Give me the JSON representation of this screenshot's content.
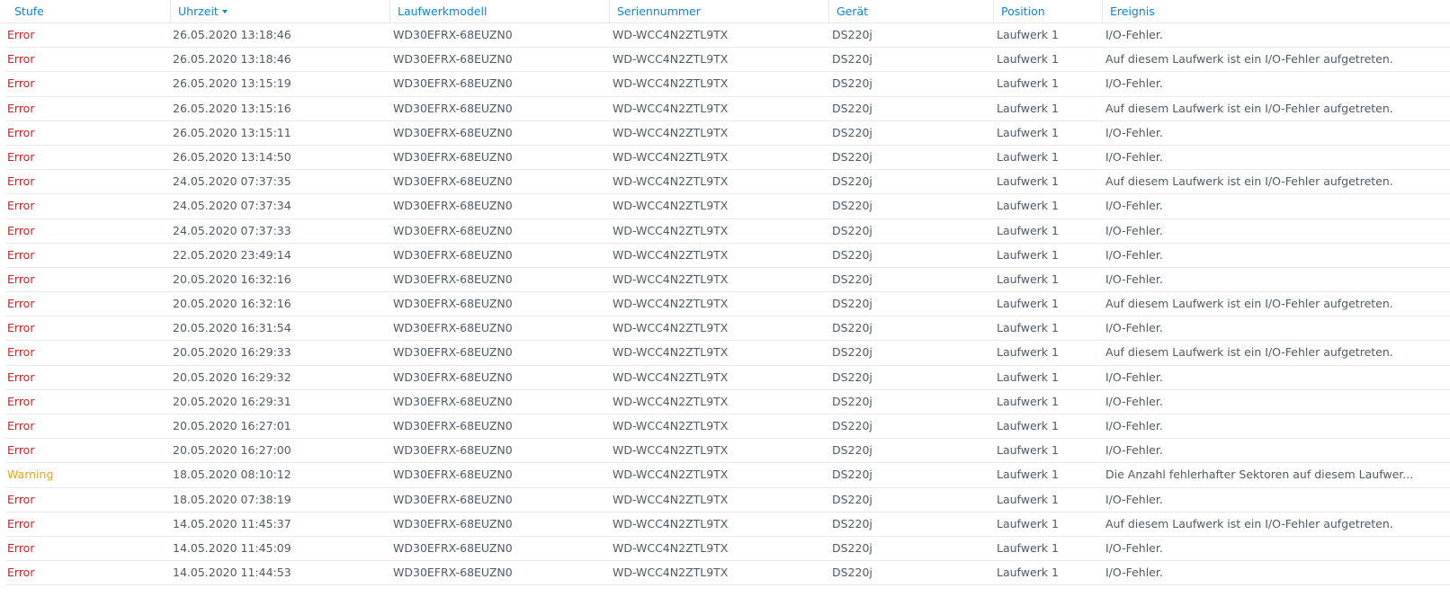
{
  "columns": [
    {
      "label": "Stufe"
    },
    {
      "label": "Uhrzeit",
      "sorted": "desc"
    },
    {
      "label": "Laufwerkmodell"
    },
    {
      "label": "Seriennummer"
    },
    {
      "label": "Gerät"
    },
    {
      "label": "Position"
    },
    {
      "label": "Ereignis"
    }
  ],
  "colors": {
    "header_text": "#0b86d4",
    "error": "#e01b1b",
    "warning": "#f0a30a",
    "text": "#505a64"
  },
  "rows": [
    {
      "level": "Error",
      "time": "26.05.2020 13:18:46",
      "model": "WD30EFRX-68EUZN0",
      "serial": "WD-WCC4N2ZTL9TX",
      "device": "DS220j",
      "position": "Laufwerk 1",
      "event": "I/O-Fehler."
    },
    {
      "level": "Error",
      "time": "26.05.2020 13:18:46",
      "model": "WD30EFRX-68EUZN0",
      "serial": "WD-WCC4N2ZTL9TX",
      "device": "DS220j",
      "position": "Laufwerk 1",
      "event": "Auf diesem Laufwerk ist ein I/O-Fehler aufgetreten."
    },
    {
      "level": "Error",
      "time": "26.05.2020 13:15:19",
      "model": "WD30EFRX-68EUZN0",
      "serial": "WD-WCC4N2ZTL9TX",
      "device": "DS220j",
      "position": "Laufwerk 1",
      "event": "I/O-Fehler."
    },
    {
      "level": "Error",
      "time": "26.05.2020 13:15:16",
      "model": "WD30EFRX-68EUZN0",
      "serial": "WD-WCC4N2ZTL9TX",
      "device": "DS220j",
      "position": "Laufwerk 1",
      "event": "Auf diesem Laufwerk ist ein I/O-Fehler aufgetreten."
    },
    {
      "level": "Error",
      "time": "26.05.2020 13:15:11",
      "model": "WD30EFRX-68EUZN0",
      "serial": "WD-WCC4N2ZTL9TX",
      "device": "DS220j",
      "position": "Laufwerk 1",
      "event": "I/O-Fehler."
    },
    {
      "level": "Error",
      "time": "26.05.2020 13:14:50",
      "model": "WD30EFRX-68EUZN0",
      "serial": "WD-WCC4N2ZTL9TX",
      "device": "DS220j",
      "position": "Laufwerk 1",
      "event": "I/O-Fehler."
    },
    {
      "level": "Error",
      "time": "24.05.2020 07:37:35",
      "model": "WD30EFRX-68EUZN0",
      "serial": "WD-WCC4N2ZTL9TX",
      "device": "DS220j",
      "position": "Laufwerk 1",
      "event": "Auf diesem Laufwerk ist ein I/O-Fehler aufgetreten."
    },
    {
      "level": "Error",
      "time": "24.05.2020 07:37:34",
      "model": "WD30EFRX-68EUZN0",
      "serial": "WD-WCC4N2ZTL9TX",
      "device": "DS220j",
      "position": "Laufwerk 1",
      "event": "I/O-Fehler."
    },
    {
      "level": "Error",
      "time": "24.05.2020 07:37:33",
      "model": "WD30EFRX-68EUZN0",
      "serial": "WD-WCC4N2ZTL9TX",
      "device": "DS220j",
      "position": "Laufwerk 1",
      "event": "I/O-Fehler."
    },
    {
      "level": "Error",
      "time": "22.05.2020 23:49:14",
      "model": "WD30EFRX-68EUZN0",
      "serial": "WD-WCC4N2ZTL9TX",
      "device": "DS220j",
      "position": "Laufwerk 1",
      "event": "I/O-Fehler."
    },
    {
      "level": "Error",
      "time": "20.05.2020 16:32:16",
      "model": "WD30EFRX-68EUZN0",
      "serial": "WD-WCC4N2ZTL9TX",
      "device": "DS220j",
      "position": "Laufwerk 1",
      "event": "I/O-Fehler."
    },
    {
      "level": "Error",
      "time": "20.05.2020 16:32:16",
      "model": "WD30EFRX-68EUZN0",
      "serial": "WD-WCC4N2ZTL9TX",
      "device": "DS220j",
      "position": "Laufwerk 1",
      "event": "Auf diesem Laufwerk ist ein I/O-Fehler aufgetreten."
    },
    {
      "level": "Error",
      "time": "20.05.2020 16:31:54",
      "model": "WD30EFRX-68EUZN0",
      "serial": "WD-WCC4N2ZTL9TX",
      "device": "DS220j",
      "position": "Laufwerk 1",
      "event": "I/O-Fehler."
    },
    {
      "level": "Error",
      "time": "20.05.2020 16:29:33",
      "model": "WD30EFRX-68EUZN0",
      "serial": "WD-WCC4N2ZTL9TX",
      "device": "DS220j",
      "position": "Laufwerk 1",
      "event": "Auf diesem Laufwerk ist ein I/O-Fehler aufgetreten."
    },
    {
      "level": "Error",
      "time": "20.05.2020 16:29:32",
      "model": "WD30EFRX-68EUZN0",
      "serial": "WD-WCC4N2ZTL9TX",
      "device": "DS220j",
      "position": "Laufwerk 1",
      "event": "I/O-Fehler."
    },
    {
      "level": "Error",
      "time": "20.05.2020 16:29:31",
      "model": "WD30EFRX-68EUZN0",
      "serial": "WD-WCC4N2ZTL9TX",
      "device": "DS220j",
      "position": "Laufwerk 1",
      "event": "I/O-Fehler."
    },
    {
      "level": "Error",
      "time": "20.05.2020 16:27:01",
      "model": "WD30EFRX-68EUZN0",
      "serial": "WD-WCC4N2ZTL9TX",
      "device": "DS220j",
      "position": "Laufwerk 1",
      "event": "I/O-Fehler."
    },
    {
      "level": "Error",
      "time": "20.05.2020 16:27:00",
      "model": "WD30EFRX-68EUZN0",
      "serial": "WD-WCC4N2ZTL9TX",
      "device": "DS220j",
      "position": "Laufwerk 1",
      "event": "I/O-Fehler."
    },
    {
      "level": "Warning",
      "time": "18.05.2020 08:10:12",
      "model": "WD30EFRX-68EUZN0",
      "serial": "WD-WCC4N2ZTL9TX",
      "device": "DS220j",
      "position": "Laufwerk 1",
      "event": "Die Anzahl fehlerhafter Sektoren auf diesem Laufwer..."
    },
    {
      "level": "Error",
      "time": "18.05.2020 07:38:19",
      "model": "WD30EFRX-68EUZN0",
      "serial": "WD-WCC4N2ZTL9TX",
      "device": "DS220j",
      "position": "Laufwerk 1",
      "event": "I/O-Fehler."
    },
    {
      "level": "Error",
      "time": "14.05.2020 11:45:37",
      "model": "WD30EFRX-68EUZN0",
      "serial": "WD-WCC4N2ZTL9TX",
      "device": "DS220j",
      "position": "Laufwerk 1",
      "event": "Auf diesem Laufwerk ist ein I/O-Fehler aufgetreten."
    },
    {
      "level": "Error",
      "time": "14.05.2020 11:45:09",
      "model": "WD30EFRX-68EUZN0",
      "serial": "WD-WCC4N2ZTL9TX",
      "device": "DS220j",
      "position": "Laufwerk 1",
      "event": "I/O-Fehler."
    },
    {
      "level": "Error",
      "time": "14.05.2020 11:44:53",
      "model": "WD30EFRX-68EUZN0",
      "serial": "WD-WCC4N2ZTL9TX",
      "device": "DS220j",
      "position": "Laufwerk 1",
      "event": "I/O-Fehler."
    }
  ]
}
